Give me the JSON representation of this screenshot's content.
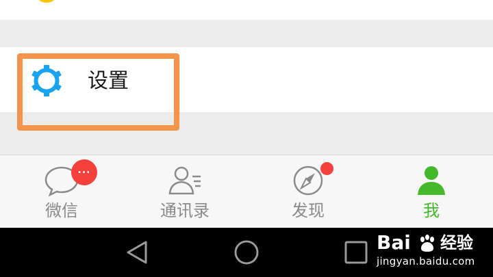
{
  "settings": {
    "label": "设置"
  },
  "tabs": [
    {
      "id": "chats",
      "label": "微信",
      "icon": "chat-bubble-icon",
      "badge": "...",
      "active": false
    },
    {
      "id": "contacts",
      "label": "通讯录",
      "icon": "contacts-icon",
      "active": false
    },
    {
      "id": "discover",
      "label": "发现",
      "icon": "compass-icon",
      "badge_dot": true,
      "active": false
    },
    {
      "id": "me",
      "label": "我",
      "icon": "person-icon",
      "active": true
    }
  ],
  "navbar": {
    "buttons": [
      "back-triangle-icon",
      "home-circle-icon",
      "recents-square-icon"
    ]
  },
  "watermark": {
    "logo": "Bai",
    "logo_suffix": "经验",
    "url": "jingyan.baidu.com"
  },
  "colors": {
    "accent_green": "#45b82b",
    "gear_blue": "#1aa4f0",
    "badge_red": "#f5413c",
    "highlight_orange": "#f4944b",
    "inactive_gray": "#8a8a8a"
  }
}
